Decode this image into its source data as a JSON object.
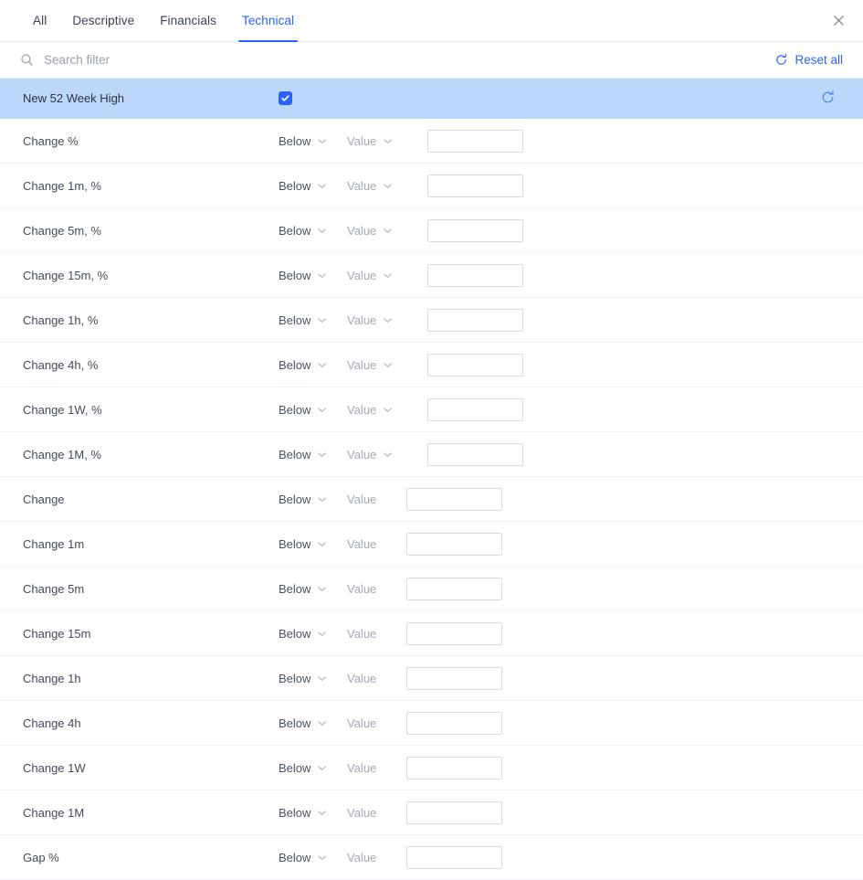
{
  "header": {
    "tabs": [
      {
        "label": "All",
        "active": false
      },
      {
        "label": "Descriptive",
        "active": false
      },
      {
        "label": "Financials",
        "active": false
      },
      {
        "label": "Technical",
        "active": true
      }
    ],
    "close_label": "×",
    "close_icon": "close-icon"
  },
  "search": {
    "placeholder": "Search filter",
    "value": "",
    "icon": "search-icon",
    "reset_all_label": "Reset all",
    "reset_all_icon": "reset-icon"
  },
  "selected_row": {
    "label": "New 52 Week High",
    "checked": true,
    "checkbox_icon": "check-icon",
    "reset_icon": "reset-icon",
    "highlight_color": "#bcd7fa"
  },
  "colors": {
    "accent": "#2962ff",
    "text": "#3c4257",
    "muted": "#a4a9b6",
    "border": "#d8dce6",
    "row_divider": "#f0f2f6"
  },
  "rows": [
    {
      "label": "Change %",
      "operator": "Below",
      "unit": "Value",
      "unit_dropdown": true,
      "value": ""
    },
    {
      "label": "Change 1m, %",
      "operator": "Below",
      "unit": "Value",
      "unit_dropdown": true,
      "value": ""
    },
    {
      "label": "Change 5m, %",
      "operator": "Below",
      "unit": "Value",
      "unit_dropdown": true,
      "value": ""
    },
    {
      "label": "Change 15m, %",
      "operator": "Below",
      "unit": "Value",
      "unit_dropdown": true,
      "value": ""
    },
    {
      "label": "Change 1h, %",
      "operator": "Below",
      "unit": "Value",
      "unit_dropdown": true,
      "value": ""
    },
    {
      "label": "Change 4h, %",
      "operator": "Below",
      "unit": "Value",
      "unit_dropdown": true,
      "value": ""
    },
    {
      "label": "Change 1W, %",
      "operator": "Below",
      "unit": "Value",
      "unit_dropdown": true,
      "value": ""
    },
    {
      "label": "Change 1M, %",
      "operator": "Below",
      "unit": "Value",
      "unit_dropdown": true,
      "value": ""
    },
    {
      "label": "Change",
      "operator": "Below",
      "unit": "Value",
      "unit_dropdown": false,
      "value": ""
    },
    {
      "label": "Change 1m",
      "operator": "Below",
      "unit": "Value",
      "unit_dropdown": false,
      "value": ""
    },
    {
      "label": "Change 5m",
      "operator": "Below",
      "unit": "Value",
      "unit_dropdown": false,
      "value": ""
    },
    {
      "label": "Change 15m",
      "operator": "Below",
      "unit": "Value",
      "unit_dropdown": false,
      "value": ""
    },
    {
      "label": "Change 1h",
      "operator": "Below",
      "unit": "Value",
      "unit_dropdown": false,
      "value": ""
    },
    {
      "label": "Change 4h",
      "operator": "Below",
      "unit": "Value",
      "unit_dropdown": false,
      "value": ""
    },
    {
      "label": "Change 1W",
      "operator": "Below",
      "unit": "Value",
      "unit_dropdown": false,
      "value": ""
    },
    {
      "label": "Change 1M",
      "operator": "Below",
      "unit": "Value",
      "unit_dropdown": false,
      "value": ""
    },
    {
      "label": "Gap %",
      "operator": "Below",
      "unit": "Value",
      "unit_dropdown": false,
      "value": ""
    }
  ]
}
